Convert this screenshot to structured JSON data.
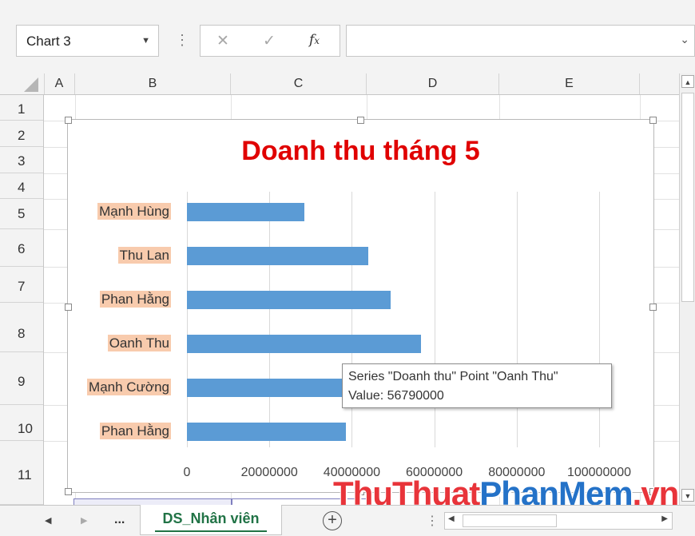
{
  "name_box": {
    "value": "Chart 3"
  },
  "formula_bar": {
    "cancel_icon": "✕",
    "enter_icon": "✓",
    "fx_label": "fx",
    "value": ""
  },
  "columns": [
    "A",
    "B",
    "C",
    "D",
    "E"
  ],
  "rows": [
    "1",
    "2",
    "3",
    "4",
    "5",
    "6",
    "7",
    "8",
    "9",
    "10",
    "11"
  ],
  "chart": {
    "title": "Doanh thu tháng 5",
    "tooltip": {
      "line1": "Series \"Doanh thu\" Point \"Oanh Thu\"",
      "line2": "Value: 56790000"
    }
  },
  "chart_data": {
    "type": "bar",
    "orientation": "horizontal",
    "title": "Doanh thu tháng 5",
    "categories": [
      "Mạnh Hùng",
      "Thu Lan",
      "Phan Hằng",
      "Oanh Thu",
      "Mạnh Cường",
      "Phan Hằng"
    ],
    "series": [
      {
        "name": "Doanh thu",
        "values": [
          28500000,
          44000000,
          49500000,
          56790000,
          41000000,
          38500000
        ]
      }
    ],
    "xlim": [
      0,
      100000000
    ],
    "xticks": [
      "0",
      "20000000",
      "40000000",
      "60000000",
      "80000000",
      "100000000"
    ],
    "grid": true,
    "bar_color": "#5b9bd5",
    "title_color": "#e00000",
    "label_highlight": "#f8cbad"
  },
  "sheet_tabs": {
    "nav_prev": "◀",
    "nav_next": "▶",
    "more": "...",
    "active": "DS_Nhân viên",
    "add": "+"
  },
  "watermark": {
    "part1": "ThuThuat",
    "part2": "PhanMem",
    "part3": ".vn"
  }
}
